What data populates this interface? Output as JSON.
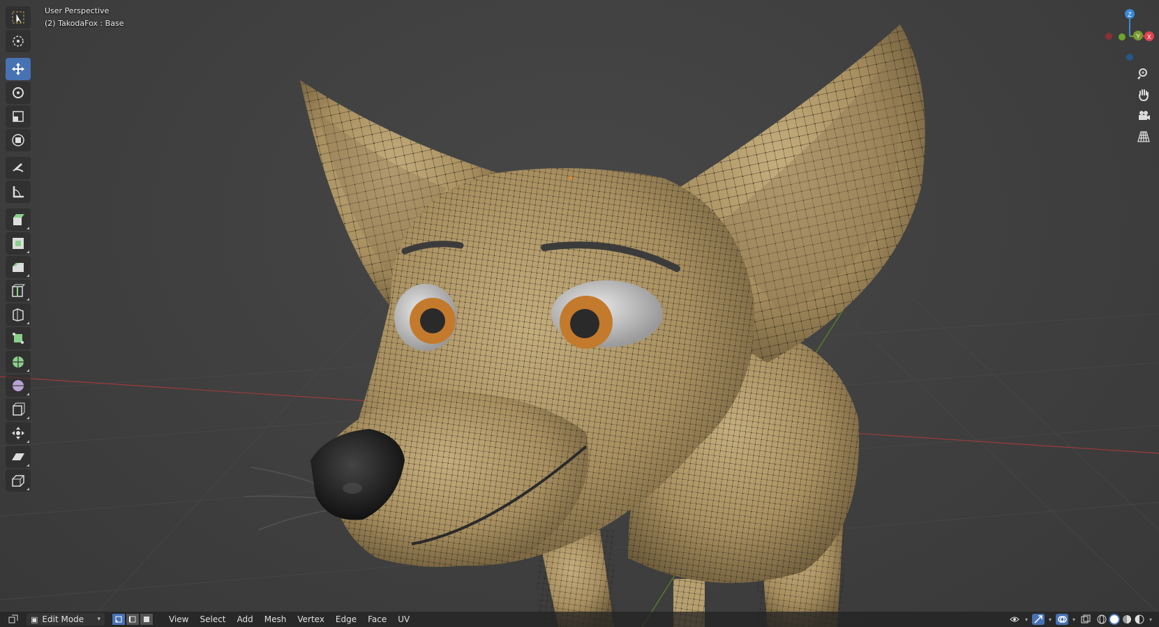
{
  "viewport": {
    "view_name": "User Perspective",
    "object_info": "(2) TakodaFox : Base"
  },
  "toolbar": {
    "tools": [
      {
        "name": "select-box-tool",
        "icon": "select-box-icon",
        "active": false
      },
      {
        "name": "cursor-tool",
        "icon": "cursor-icon",
        "active": false
      },
      {
        "name": "move-tool",
        "icon": "move-icon",
        "active": true
      },
      {
        "name": "rotate-tool",
        "icon": "rotate-icon",
        "active": false
      },
      {
        "name": "scale-tool",
        "icon": "scale-icon",
        "active": false
      },
      {
        "name": "transform-tool",
        "icon": "transform-icon",
        "active": false
      },
      {
        "name": "annotate-tool",
        "icon": "annotate-icon",
        "active": false
      },
      {
        "name": "measure-tool",
        "icon": "measure-icon",
        "active": false
      },
      {
        "name": "extrude-tool",
        "icon": "extrude-icon",
        "active": false
      },
      {
        "name": "inset-tool",
        "icon": "inset-icon",
        "active": false
      },
      {
        "name": "bevel-tool",
        "icon": "bevel-icon",
        "active": false
      },
      {
        "name": "loop-cut-tool",
        "icon": "loop-cut-icon",
        "active": false
      },
      {
        "name": "knife-tool",
        "icon": "knife-icon",
        "active": false
      },
      {
        "name": "poly-build-tool",
        "icon": "poly-build-icon",
        "active": false
      },
      {
        "name": "spin-tool",
        "icon": "spin-icon",
        "active": false
      },
      {
        "name": "smooth-tool",
        "icon": "smooth-icon",
        "active": false
      },
      {
        "name": "edge-slide-tool",
        "icon": "edge-slide-icon",
        "active": false
      },
      {
        "name": "shrink-fatten-tool",
        "icon": "shrink-fatten-icon",
        "active": false
      },
      {
        "name": "shear-tool",
        "icon": "shear-icon",
        "active": false
      },
      {
        "name": "rip-tool",
        "icon": "rip-icon",
        "active": false
      }
    ]
  },
  "gizmo": {
    "z_label": "Z",
    "y_label": "Y",
    "x_label": "X",
    "colors": {
      "x": "#e0414f",
      "y": "#6ea52a",
      "z": "#3a8ad8"
    }
  },
  "header": {
    "mode_label": "Edit Mode",
    "menus": [
      "View",
      "Select",
      "Add",
      "Mesh",
      "Vertex",
      "Edge",
      "Face",
      "UV"
    ]
  },
  "colors": {
    "accent": "#4772b3",
    "fur": "#b09868",
    "grid": "#4a4a4a",
    "x_axis": "#9c3b3b",
    "y_axis": "#5a8a2a"
  }
}
